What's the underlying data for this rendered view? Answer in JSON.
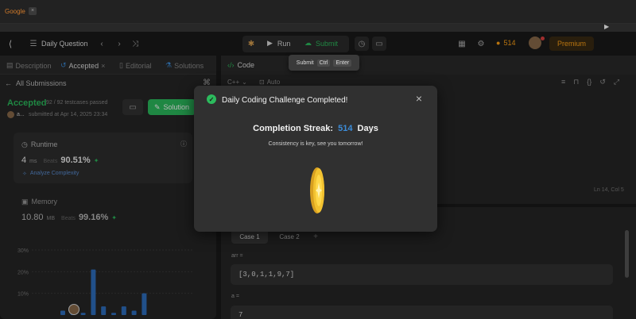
{
  "browser": {
    "tab_label": "Google"
  },
  "topnav": {
    "title": "Daily Question",
    "run_label": "Run",
    "submit_label": "Submit",
    "streak_count": "514",
    "premium_label": "Premium"
  },
  "tooltip": {
    "label": "Submit",
    "key1": "Ctrl",
    "key2": "Enter"
  },
  "left": {
    "tabs": [
      {
        "label": "Description"
      },
      {
        "label": "Accepted"
      },
      {
        "label": "Editorial"
      },
      {
        "label": "Solutions"
      }
    ],
    "back_label": "All Submissions",
    "status": "Accepted",
    "testcases": "92 / 92 testcases passed",
    "user": "a...",
    "submitted": "submitted at Apr 14, 2025 23:34",
    "solution_btn": "Solution",
    "runtime": {
      "label": "Runtime",
      "value": "4",
      "unit": "ms",
      "beats_label": "Beats",
      "beats_value": "90.51%",
      "analyze": "Analyze Complexity"
    },
    "memory": {
      "label": "Memory",
      "value": "10.80",
      "unit": "MB",
      "beats_label": "Beats",
      "beats_value": "99.16%"
    },
    "chart": {
      "ticks": [
        "30%",
        "20%",
        "10%"
      ]
    }
  },
  "right": {
    "code_tab": "Code",
    "language": "C++",
    "auto": "Auto",
    "cursor_pos": "Ln 14, Col 5",
    "case_tabs": [
      {
        "label": "Case 1"
      },
      {
        "label": "Case 2"
      }
    ],
    "add_case": "+",
    "var1_name": "arr =",
    "var1_value": "[3,0,1,1,9,7]",
    "var2_name": "a =",
    "var2_value": "7"
  },
  "modal": {
    "title": "Daily Coding Challenge Completed!",
    "streak_label": "Completion Streak:",
    "streak_value": "514",
    "streak_unit": "Days",
    "message": "Consistency is key, see you tomorrow!"
  },
  "colors": {
    "accent_green": "#2cbb5d",
    "accent_blue": "#3c8cd8",
    "premium": "#ffa116"
  },
  "chart_data": {
    "type": "bar",
    "title": "",
    "xlabel": "",
    "ylabel": "",
    "yticks": [
      "30%",
      "20%",
      "10%"
    ],
    "ylim": [
      0,
      30
    ],
    "values": [
      2,
      3,
      1,
      21,
      4,
      1,
      4,
      2,
      10
    ]
  }
}
